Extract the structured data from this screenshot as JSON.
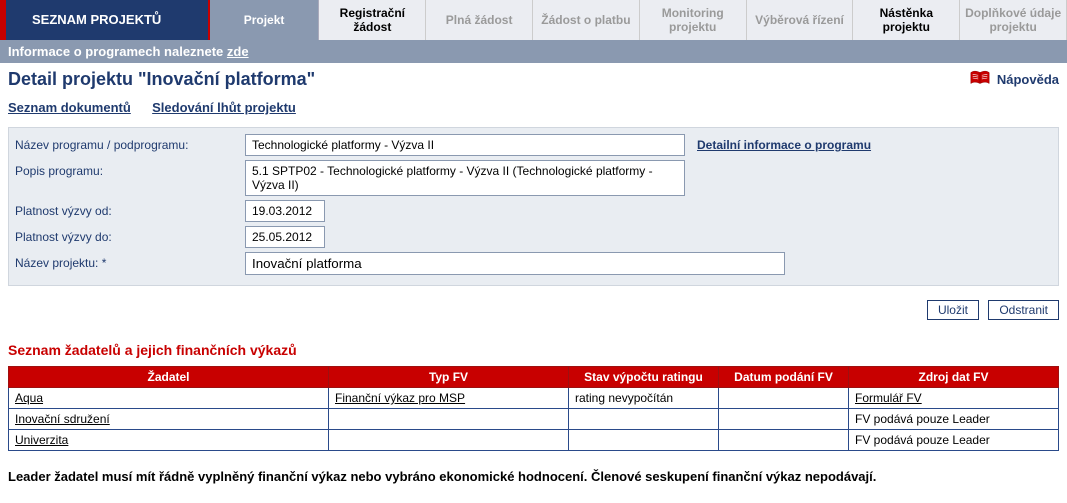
{
  "tabs": {
    "seznam": "SEZNAM PROJEKTŮ",
    "projekt": "Projekt",
    "registracni": "Registrační žádost",
    "plna": "Plná žádost",
    "platbu": "Žádost o platbu",
    "monitoring": "Monitoring projektu",
    "vyberova": "Výběrová řízení",
    "nastenka": "Nástěnka projektu",
    "doplnkove": "Doplňkové údaje projektu"
  },
  "infobar": {
    "text": "Informace o programech naleznete ",
    "link": "zde"
  },
  "title": "Detail projektu   \"Inovační platforma\"",
  "help_label": "Nápověda",
  "sublinks": {
    "docs": "Seznam dokumentů",
    "deadlines": "Sledování lhůt projektu"
  },
  "form": {
    "program_name_label": "Název programu / podprogramu:",
    "program_name_value": "Technologické platformy - Výzva II",
    "detail_link": "Detailní informace o programu",
    "program_desc_label": "Popis programu:",
    "program_desc_value": "5.1 SPTP02 - Technologické platformy - Výzva II (Technologické platformy - Výzva II)",
    "valid_from_label": "Platnost výzvy od:",
    "valid_from_value": "19.03.2012",
    "valid_to_label": "Platnost výzvy do:",
    "valid_to_value": "25.05.2012",
    "project_name_label": "Název projektu: *",
    "project_name_value": "Inovační platforma"
  },
  "buttons": {
    "save": "Uložit",
    "delete": "Odstranit"
  },
  "applicants_heading": "Seznam žadatelů a jejich finančních výkazů",
  "table": {
    "headers": {
      "applicant": "Žadatel",
      "fv_type": "Typ FV",
      "rating_status": "Stav výpočtu ratingu",
      "submit_date": "Datum podání FV",
      "fv_source": "Zdroj dat FV"
    },
    "rows": [
      {
        "applicant": "Aqua",
        "fv_type": "Finanční výkaz pro MSP",
        "rating_status": "rating nevypočítán",
        "submit_date": "",
        "fv_source": "Formulář FV",
        "applicant_link": true,
        "fv_type_link": true,
        "fv_source_link": true
      },
      {
        "applicant": "Inovační sdružení",
        "fv_type": "",
        "rating_status": "",
        "submit_date": "",
        "fv_source": "FV podává pouze Leader",
        "applicant_link": true,
        "fv_type_link": false,
        "fv_source_link": false
      },
      {
        "applicant": "Univerzita",
        "fv_type": "",
        "rating_status": "",
        "submit_date": "",
        "fv_source": "FV podává pouze Leader",
        "applicant_link": true,
        "fv_type_link": false,
        "fv_source_link": false
      }
    ]
  },
  "footnote": "Leader žadatel musí mít řádně vyplněný finanční výkaz nebo vybráno ekonomické hodnocení. Členové seskupení finanční výkaz nepodávají."
}
